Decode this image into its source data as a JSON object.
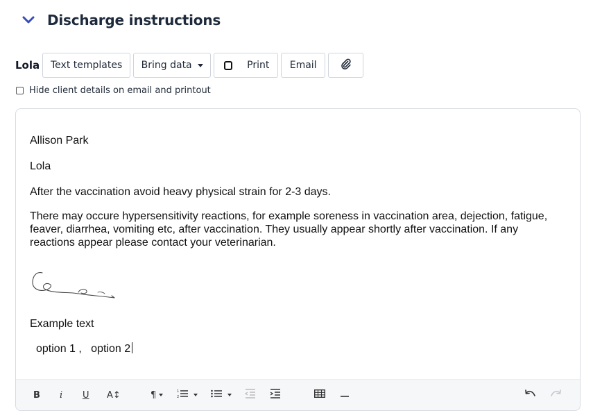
{
  "section": {
    "title": "Discharge instructions",
    "toggle_icon": "chevron-down-icon",
    "accent_color": "#3b4db8"
  },
  "toolbar": {
    "pet_name": "Lola",
    "text_templates_label": "Text templates",
    "bring_data_label": "Bring data",
    "print_label": "Print",
    "email_label": "Email",
    "attach_icon": "paperclip-icon"
  },
  "options": {
    "hide_client_label": "Hide client details on email and printout",
    "hide_client_checked": false
  },
  "editor": {
    "client_name": "Allison Park",
    "pet_name": "Lola",
    "paragraph_1": "After the vaccination avoid heavy physical strain for 2-3 days.",
    "paragraph_2": "There may occure hypersensitivity reactions, for example soreness in vaccination area, dejection, fatigue, feaver, diarrhea, vomiting etc, after vaccination. They usually appear shortly after vaccination. If any reactions appear please contact your veterinarian.",
    "example_text": "Example text",
    "options_text": "option 1 ,   option 2"
  },
  "editor_toolbar": {
    "bold_label": "B",
    "italic_label": "i",
    "underline_label": "U",
    "font_size_label": "A↕",
    "icons": [
      "bold-icon",
      "italic-icon",
      "underline-icon",
      "font-size-icon",
      "paragraph-icon",
      "ordered-list-icon",
      "bullet-list-icon",
      "outdent-icon",
      "indent-icon",
      "table-icon",
      "horizontal-rule-icon",
      "undo-icon",
      "redo-icon"
    ]
  }
}
